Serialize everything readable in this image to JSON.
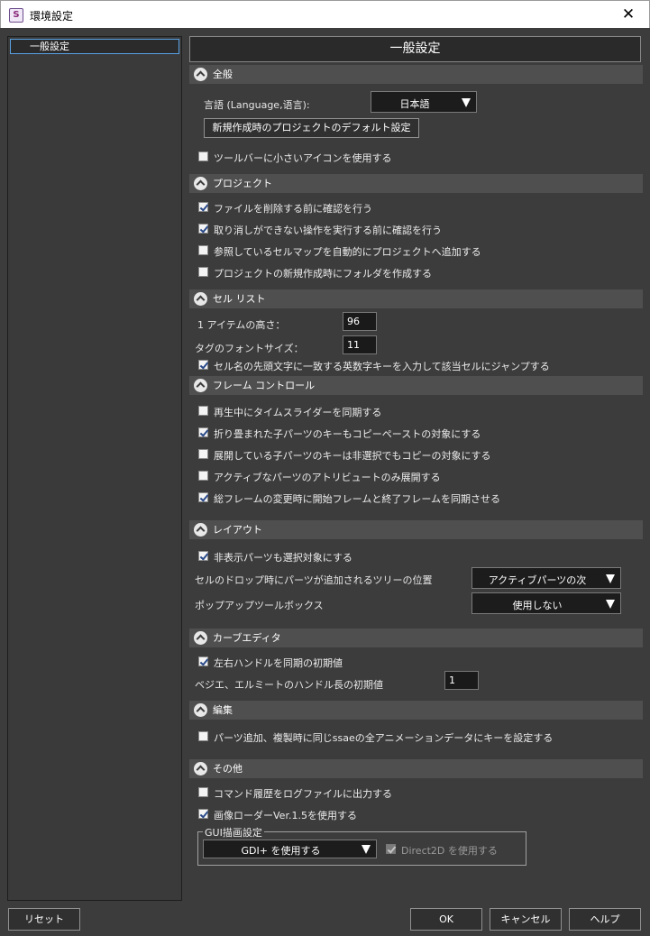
{
  "window": {
    "title": "環境設定",
    "app_icon_letter": "S",
    "close_glyph": "✕"
  },
  "nav": {
    "items": [
      {
        "label": "一般設定"
      }
    ]
  },
  "panel": {
    "title": "一般設定"
  },
  "sections": {
    "general": {
      "title": "全般",
      "language_label": "言語 (Language,语言):",
      "language_value": "日本語",
      "project_defaults_button": "新規作成時のプロジェクトのデフォルト設定",
      "small_icons": {
        "label": "ツールバーに小さいアイコンを使用する",
        "checked": false
      }
    },
    "project": {
      "title": "プロジェクト",
      "options": [
        {
          "label": "ファイルを削除する前に確認を行う",
          "checked": true
        },
        {
          "label": "取り消しができない操作を実行する前に確認を行う",
          "checked": true
        },
        {
          "label": "参照しているセルマップを自動的にプロジェクトへ追加する",
          "checked": false
        },
        {
          "label": "プロジェクトの新規作成時にフォルダを作成する",
          "checked": false
        }
      ]
    },
    "cell_list": {
      "title": "セル リスト",
      "item_height_label": "1 アイテムの高さ：",
      "item_height_value": "96",
      "tag_font_size_label": "タグのフォントサイズ：",
      "tag_font_size_value": "11",
      "jump_option": {
        "label": "セル名の先頭文字に一致する英数字キーを入力して該当セルにジャンプする",
        "checked": true
      }
    },
    "frame_control": {
      "title": "フレーム コントロール",
      "options": [
        {
          "label": "再生中にタイムスライダーを同期する",
          "checked": false
        },
        {
          "label": "折り畳まれた子パーツのキーもコピーペーストの対象にする",
          "checked": true
        },
        {
          "label": "展開している子パーツのキーは非選択でもコピーの対象にする",
          "checked": false
        },
        {
          "label": "アクティブなパーツのアトリビュートのみ展開する",
          "checked": false
        },
        {
          "label": "総フレームの変更時に開始フレームと終了フレームを同期させる",
          "checked": true
        }
      ]
    },
    "layout": {
      "title": "レイアウト",
      "hidden_selectable": {
        "label": "非表示パーツも選択対象にする",
        "checked": true
      },
      "tree_position_label": "セルのドロップ時にパーツが追加されるツリーの位置",
      "tree_position_value": "アクティブパーツの次",
      "popup_toolbox_label": "ポップアップツールボックス",
      "popup_toolbox_value": "使用しない"
    },
    "curve_editor": {
      "title": "カーブエディタ",
      "sync_handles": {
        "label": "左右ハンドルを同期の初期値",
        "checked": true
      },
      "handle_length_label": "ベジエ、エルミートのハンドル長の初期値",
      "handle_length_value": "1"
    },
    "edit": {
      "title": "編集",
      "set_keys": {
        "label": "パーツ追加、複製時に同じssaeの全アニメーションデータにキーを設定する",
        "checked": false
      }
    },
    "other": {
      "title": "その他",
      "log_commands": {
        "label": "コマンド履歴をログファイルに出力する",
        "checked": false
      },
      "image_loader": {
        "label": "画像ローダーVer.1.5を使用する",
        "checked": true
      },
      "gui_group_title": "GUI描画設定",
      "gdi_value": "GDI+ を使用する",
      "direct2d": {
        "label": "Direct2D を使用する",
        "checked": true,
        "enabled": false
      }
    }
  },
  "footer": {
    "reset": "リセット",
    "ok": "OK",
    "cancel": "キャンセル",
    "help": "ヘルプ"
  }
}
